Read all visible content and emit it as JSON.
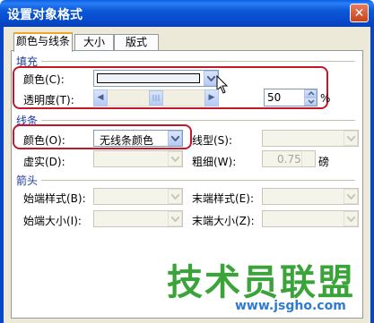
{
  "window": {
    "title": "设置对象格式"
  },
  "tabs": [
    {
      "label": "颜色与线条"
    },
    {
      "label": "大小"
    },
    {
      "label": "版式"
    }
  ],
  "fill": {
    "section_label": "填充",
    "color_label": "颜色(C):",
    "transparency_label": "透明度(T):",
    "transparency_value": "50",
    "transparency_unit": "%",
    "slider_level_percent": 50
  },
  "line": {
    "section_label": "线条",
    "color_label": "颜色(O):",
    "color_value": "无线条颜色",
    "style_label": "线型(S):",
    "dash_label": "虚实(D):",
    "weight_label": "粗细(W):",
    "weight_value": "0.75",
    "weight_unit": "磅"
  },
  "arrows": {
    "section_label": "箭头",
    "begin_style_label": "始端样式(B):",
    "end_style_label": "末端样式(E):",
    "begin_size_label": "始端大小(I):",
    "end_size_label": "末端大小(Z):"
  },
  "watermark": {
    "text": "技术员联盟",
    "subtext": "www.jsgho.com"
  },
  "colors": {
    "highlight": "#c4182a",
    "title_bar": "#0b58d8"
  }
}
